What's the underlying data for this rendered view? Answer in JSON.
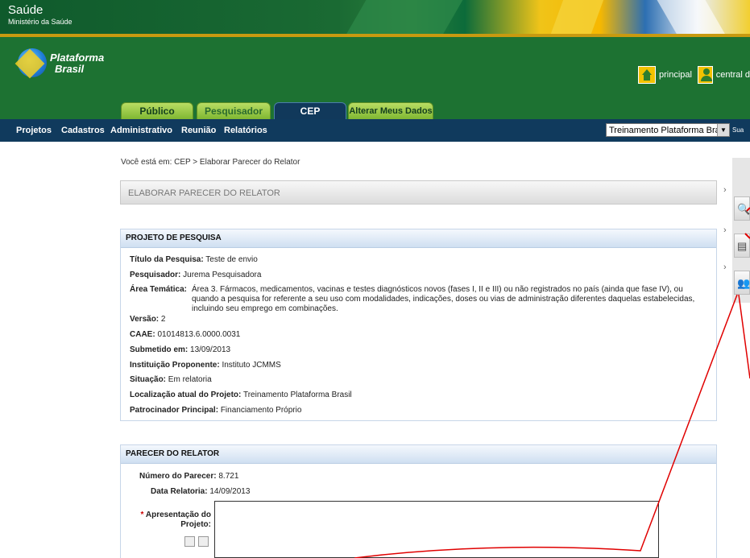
{
  "banner": {
    "title": "Saúde",
    "subtitle": "Ministério da Saúde"
  },
  "logo": {
    "line1": "Plataforma",
    "line2": "Brasil"
  },
  "header_links": {
    "principal": "principal",
    "central": "central d"
  },
  "tabs": [
    {
      "label": "Público"
    },
    {
      "label": "Pesquisador"
    },
    {
      "label": "CEP"
    },
    {
      "label": "Alterar Meus Dados"
    }
  ],
  "nav": {
    "items": [
      "Projetos",
      "Cadastros",
      "Administrativo",
      "Reunião",
      "Relatórios"
    ],
    "select_value": "Treinamento Plataforma Brasil",
    "after_select": "Sua"
  },
  "breadcrumb": "Você está em: CEP > Elaborar Parecer do Relator",
  "page_title": "ELABORAR PARECER DO RELATOR",
  "projeto": {
    "heading": "PROJETO DE PESQUISA",
    "titulo_label": "Título da Pesquisa:",
    "titulo_value": "Teste de envio",
    "pesquisador_label": "Pesquisador:",
    "pesquisador_value": "Jurema Pesquisadora",
    "area_label": "Área Temática:",
    "area_value": "Área 3. Fármacos, medicamentos, vacinas e testes diagnósticos novos (fases I, II e III) ou não registrados no país (ainda que fase IV), ou quando a pesquisa for referente a seu uso com modalidades, indicações, doses ou vias de administração diferentes daquelas estabelecidas, incluindo seu emprego em combinações.",
    "versao_label": "Versão:",
    "versao_value": "2",
    "caae_label": "CAAE:",
    "caae_value": "01014813.6.0000.0031",
    "submetido_label": "Submetido em:",
    "submetido_value": "13/09/2013",
    "instituicao_label": "Instituição Proponente:",
    "instituicao_value": "Instituto JCMMS",
    "situacao_label": "Situação:",
    "situacao_value": "Em relatoria",
    "localizacao_label": "Localização atual do Projeto:",
    "localizacao_value": "Treinamento Plataforma Brasil",
    "patrocinador_label": "Patrocinador Principal:",
    "patrocinador_value": "Financiamento Próprio"
  },
  "parecer": {
    "heading": "PARECER DO RELATOR",
    "numero_label": "Número do Parecer:",
    "numero_value": "8.721",
    "data_label": "Data Relatoria:",
    "data_value": "14/09/2013",
    "apresentacao_label1": "Apresentação do",
    "apresentacao_label2": "Projeto:",
    "required_mark": "*"
  },
  "colors": {
    "header_green": "#1d7232",
    "nav_blue": "#103a5d",
    "annotation_red": "#e00000"
  }
}
